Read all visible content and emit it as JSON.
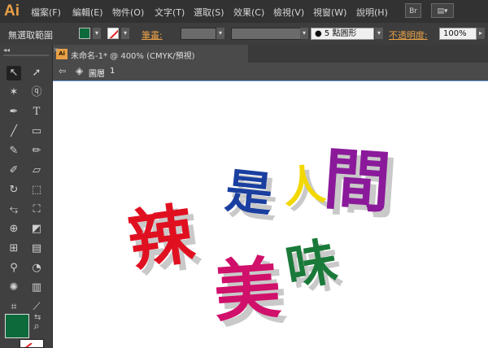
{
  "app": {
    "logo": "Ai"
  },
  "menu": [
    "檔案(F)",
    "編輯(E)",
    "物件(O)",
    "文字(T)",
    "選取(S)",
    "效果(C)",
    "檢視(V)",
    "視窗(W)",
    "說明(H)"
  ],
  "top_buttons": {
    "bridge": "Br",
    "arrange": "▤▾"
  },
  "control_bar": {
    "selection_status": "無選取範圍",
    "fill_color": "#0d6a3b",
    "stroke_label": "筆畫:",
    "brush_value": "5 點圓形",
    "opacity_label": "不透明度:",
    "opacity_value": "100%"
  },
  "document_tab": {
    "title": "未命名-1* @ 400% (CMYK/預視)",
    "close": "×"
  },
  "layer_bar": {
    "name": "圖層",
    "number": "1"
  },
  "artwork": {
    "glyphs": [
      {
        "char": "辣",
        "color": "#e01020"
      },
      {
        "char": "是",
        "color": "#1a3fa0"
      },
      {
        "char": "人",
        "color": "#f2d800"
      },
      {
        "char": "間",
        "color": "#8b1a9b"
      },
      {
        "char": "美",
        "color": "#d0106a"
      },
      {
        "char": "味",
        "color": "#1a7a3a"
      }
    ],
    "shadow_color": "#c9c9c9"
  },
  "tool_colors": {
    "fill": "#0d6a3b",
    "stroke": "#ffffff"
  }
}
